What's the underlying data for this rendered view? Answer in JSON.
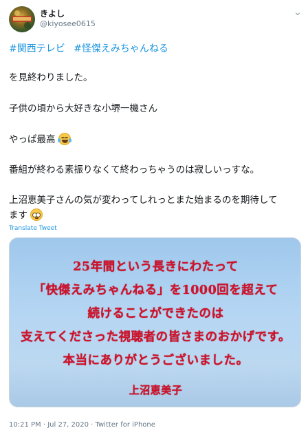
{
  "user": {
    "name": "きよし",
    "handle": "@kiyosee0615"
  },
  "hashtags": [
    "#関西テレビ",
    "#怪傑えみちゃんねる"
  ],
  "tweet_lines": [
    "を見終わりました。",
    "子供の頃から大好きな小堺一機さん",
    "やっぱ最高",
    "番組が終わる素振りなくて終わっちゃうのは寂しいっすな。",
    "上沼恵美子さんの気が変わってしれっとまた始まるのを期待して",
    "ます"
  ],
  "translate_label": "Translate Tweet",
  "image_text": {
    "lines": [
      "25年間という長きにわたって",
      "「快傑えみちゃんねる」を1000回を超えて",
      "続けることができたのは",
      "支えてくださった視聴者の皆さまのおかげです。",
      "本当にありがとうございました。"
    ],
    "signature": "上沼恵美子"
  },
  "meta": {
    "time": "10:21 PM",
    "date": "Jul 27, 2020",
    "source": "Twitter for iPhone"
  },
  "icons": {
    "more": "more-icon",
    "emoji_1": "tears-of-joy-emoji",
    "emoji_2": "pleading-face-emoji"
  },
  "colors": {
    "link": "#1b95e0",
    "caption_red": "#d0122b",
    "muted": "#657786"
  }
}
